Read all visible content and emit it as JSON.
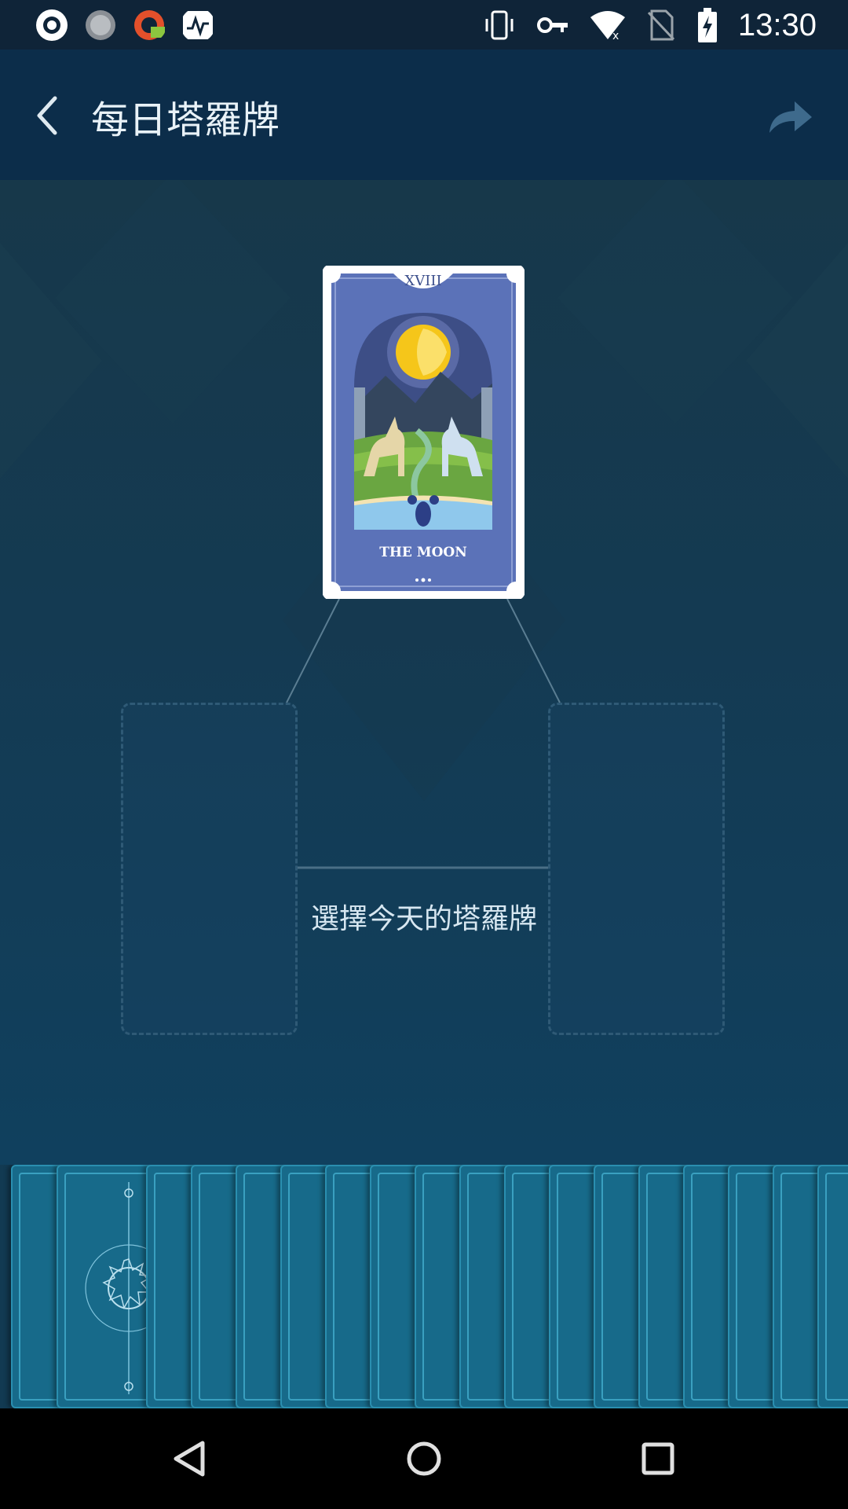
{
  "status_bar": {
    "time": "13:30",
    "left_icons": [
      "app-icon-1",
      "app-icon-2",
      "app-icon-3",
      "activity-icon"
    ],
    "right_icons": [
      "vibrate-icon",
      "vpn-key-icon",
      "wifi-icon",
      "no-sim-icon",
      "battery-charging-icon"
    ]
  },
  "app_bar": {
    "title": "每日塔羅牌",
    "back_icon": "back-arrow-icon",
    "share_icon": "share-arrow-icon"
  },
  "selected_card": {
    "numeral": "XVIII",
    "name": "THE MOON"
  },
  "prompt": "選擇今天的塔羅牌",
  "colors": {
    "app_bar": "#0c2d4a",
    "background": "#143a52",
    "card_blue": "#5b72b8",
    "deck_card": "#176a8a"
  },
  "nav_bar": {
    "icons": [
      "back-triangle-icon",
      "home-circle-icon",
      "recents-square-icon"
    ]
  }
}
